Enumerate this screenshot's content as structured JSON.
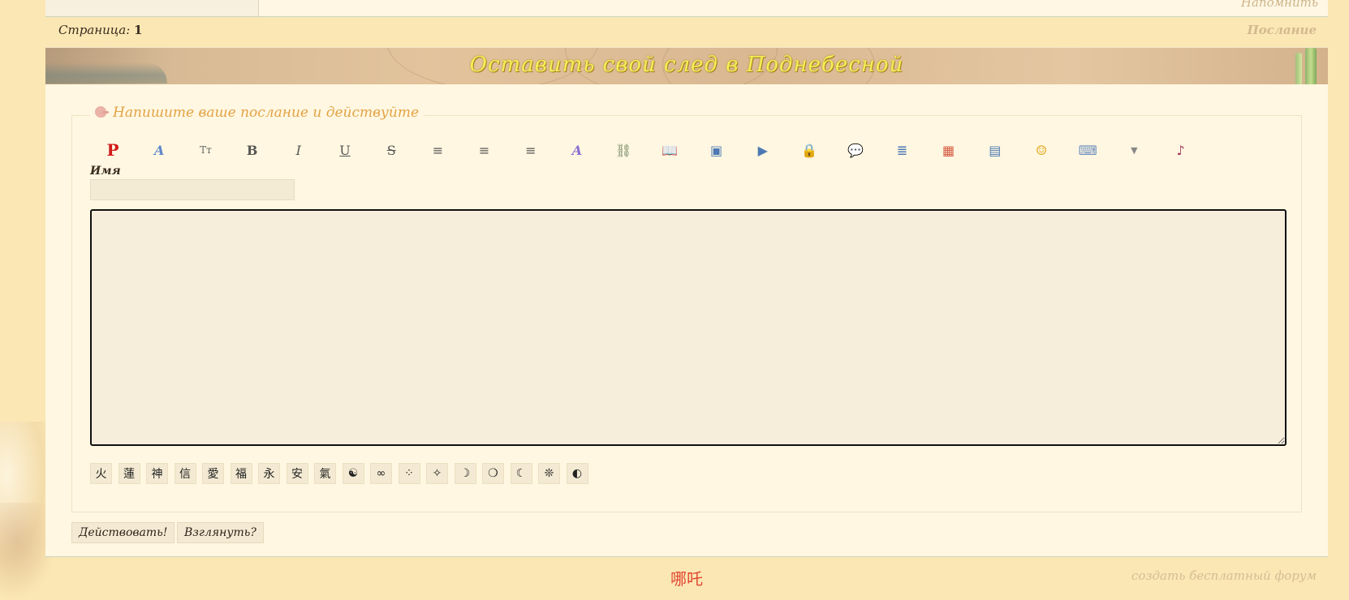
{
  "top": {
    "remind_link": "Напомнить"
  },
  "page_line": {
    "pages_label": "Страница:",
    "page_number": "1",
    "post_link": "Послание"
  },
  "banner": {
    "title": "Оставить свой след в Поднебесной"
  },
  "form": {
    "legend": "Напишите ваше послание и действуйте",
    "name_label": "Имя",
    "name_value": "",
    "message_value": ""
  },
  "toolbar": [
    {
      "name": "paragraph-icon",
      "glyph": "P",
      "color": "#d11a1a"
    },
    {
      "name": "font-face-icon",
      "glyph": "A",
      "color": "#5f86c9"
    },
    {
      "name": "font-size-icon",
      "glyph": "Tт",
      "color": "#666"
    },
    {
      "name": "bold-icon",
      "glyph": "B",
      "color": "#555"
    },
    {
      "name": "italic-icon",
      "glyph": "I",
      "color": "#555"
    },
    {
      "name": "underline-icon",
      "glyph": "U",
      "color": "#555"
    },
    {
      "name": "strikethrough-icon",
      "glyph": "S",
      "color": "#555"
    },
    {
      "name": "align-left-icon",
      "glyph": "≡",
      "color": "#555"
    },
    {
      "name": "align-center-icon",
      "glyph": "≡",
      "color": "#555"
    },
    {
      "name": "align-right-icon",
      "glyph": "≡",
      "color": "#555"
    },
    {
      "name": "font-color-icon",
      "glyph": "A",
      "color": "#8a6fd1"
    },
    {
      "name": "link-icon",
      "glyph": "⛓",
      "color": "#6a7f5a"
    },
    {
      "name": "book-icon",
      "glyph": "📖",
      "color": "#4c79b4"
    },
    {
      "name": "image-icon",
      "glyph": "▣",
      "color": "#4c79b4"
    },
    {
      "name": "video-icon",
      "glyph": "▶",
      "color": "#4c79b4"
    },
    {
      "name": "lock-icon",
      "glyph": "🔒",
      "color": "#d4a020"
    },
    {
      "name": "quote-icon",
      "glyph": "💬",
      "color": "#4c79b4"
    },
    {
      "name": "code-icon",
      "glyph": "≣",
      "color": "#4c79b4"
    },
    {
      "name": "color-palette-icon",
      "glyph": "▦",
      "color": "#d4583f"
    },
    {
      "name": "table-icon",
      "glyph": "▤",
      "color": "#4c79b4"
    },
    {
      "name": "smiley-icon",
      "glyph": "☺",
      "color": "#e3a81c"
    },
    {
      "name": "keyboard-icon",
      "glyph": "⌨",
      "color": "#6c8fbf"
    },
    {
      "name": "dropdown-arrow-icon",
      "glyph": "▼",
      "color": "#888"
    },
    {
      "name": "music-note-icon",
      "glyph": "♪",
      "color": "#a0365a"
    }
  ],
  "symbols": [
    "火",
    "蓮",
    "神",
    "信",
    "愛",
    "福",
    "永",
    "安",
    "氣",
    "☯",
    "∞",
    "⁘",
    "✧",
    "☽",
    "❍",
    "☾",
    "❊",
    "◐"
  ],
  "buttons": {
    "submit": "Действовать!",
    "preview": "Взглянуть?"
  },
  "footer": {
    "char": "哪吒",
    "create_forum": "создать бесплатный форум"
  }
}
